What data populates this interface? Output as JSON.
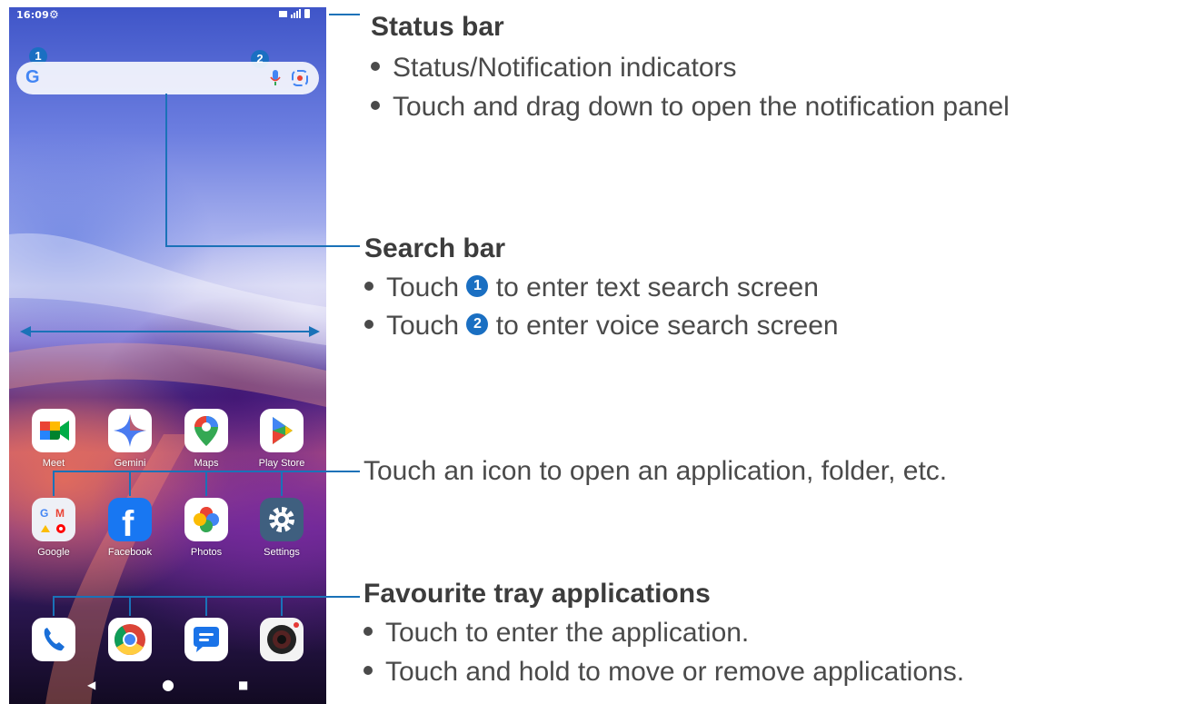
{
  "status_bar": {
    "time": "16:09"
  },
  "search": {
    "badge_text_search": "1",
    "badge_voice_search": "2"
  },
  "apps": [
    {
      "name": "Meet"
    },
    {
      "name": "Gemini"
    },
    {
      "name": "Maps"
    },
    {
      "name": "Play Store"
    },
    {
      "name": "Google"
    },
    {
      "name": "Facebook"
    },
    {
      "name": "Photos"
    },
    {
      "name": "Settings"
    }
  ],
  "annotations": {
    "status_bar": {
      "title": "Status bar",
      "bullets": [
        "Status/Notification indicators",
        "Touch and drag down to open the notification panel"
      ]
    },
    "search_bar": {
      "title": "Search bar",
      "bullet1_pre": "Touch",
      "bullet1_num": "1",
      "bullet1_post": "to enter text search screen",
      "bullet2_pre": "Touch",
      "bullet2_num": "2",
      "bullet2_post": "to enter voice search screen"
    },
    "apps": {
      "text": "Touch an icon to open an application, folder, etc."
    },
    "favourites": {
      "title": "Favourite tray applications",
      "bullets": [
        "Touch to enter the application.",
        "Touch and hold to move or remove applications."
      ]
    }
  },
  "colors": {
    "accent": "#1a72b8",
    "text": "#4a4a4a"
  }
}
